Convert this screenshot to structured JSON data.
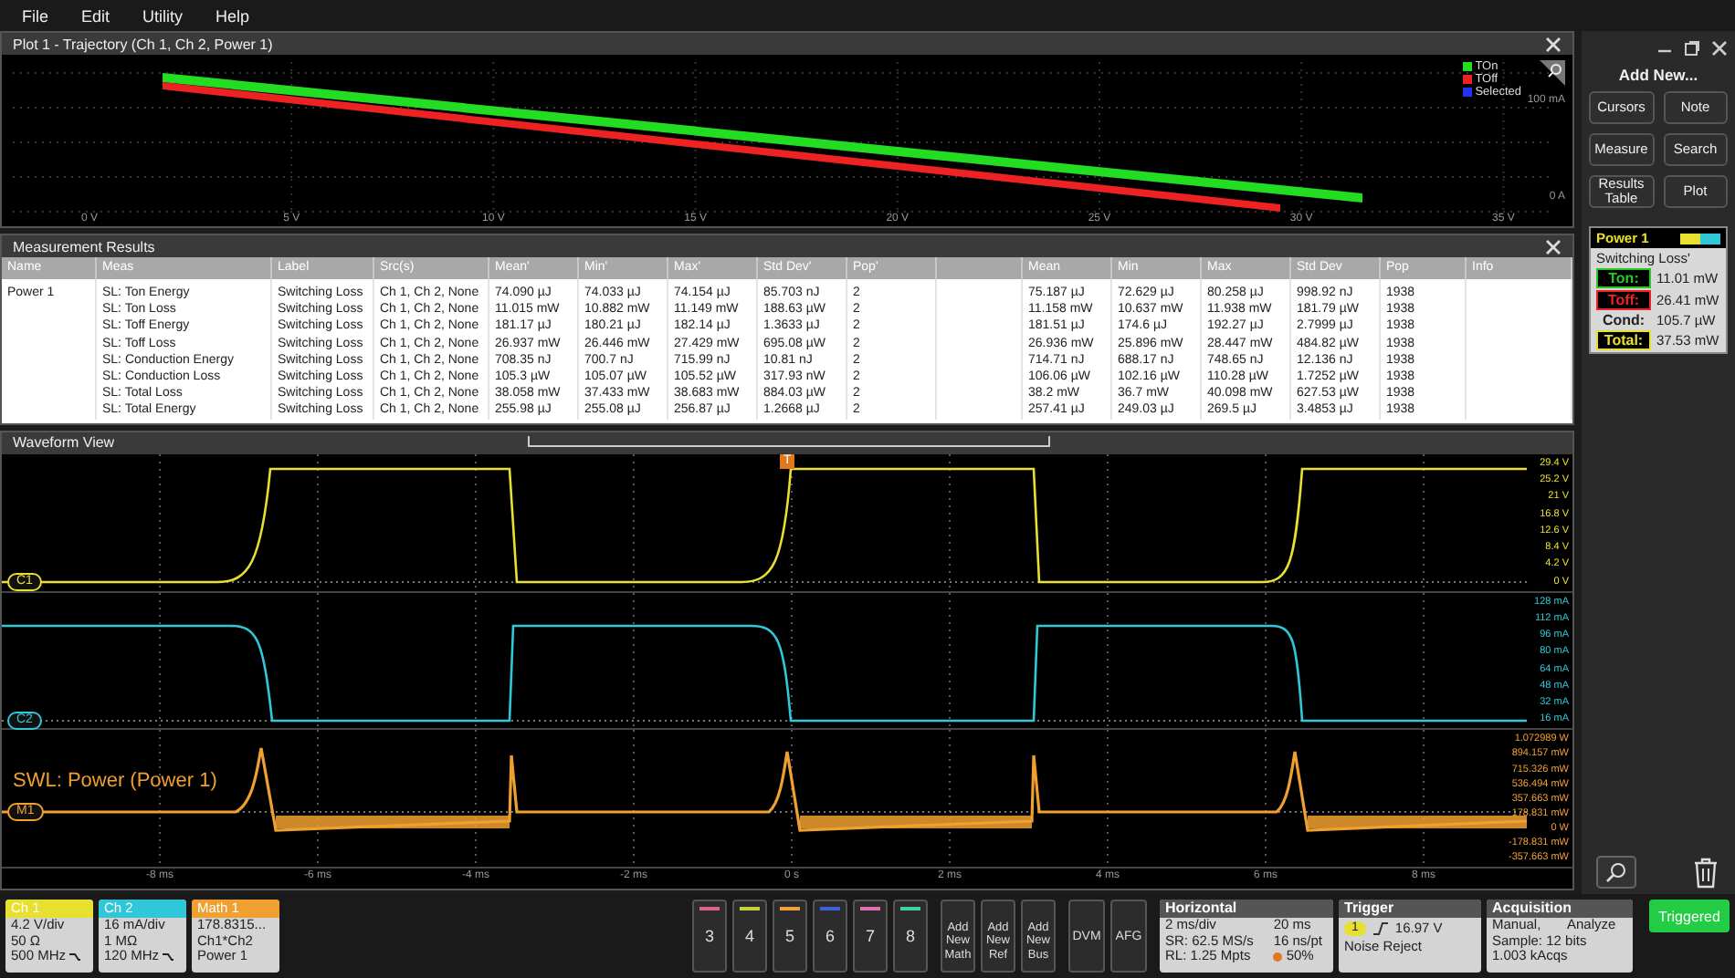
{
  "menu": [
    {
      "label": "File"
    },
    {
      "label": "Edit"
    },
    {
      "label": "Utility"
    },
    {
      "label": "Help"
    }
  ],
  "plot": {
    "title": "Plot 1 - Trajectory (Ch 1, Ch 2, Power 1)",
    "legend": [
      {
        "label": "TOn",
        "color": "#22dd22"
      },
      {
        "label": "TOff",
        "color": "#ee2222"
      },
      {
        "label": "Selected",
        "color": "#2233ee"
      }
    ],
    "x_labels": [
      "0 V",
      "5 V",
      "10 V",
      "15 V",
      "20 V",
      "25 V",
      "30 V",
      "35 V"
    ],
    "y_labels": [
      "100 mA",
      "0 A"
    ]
  },
  "measurement_results": {
    "title": "Measurement Results",
    "columns": [
      "Name",
      "Meas",
      "Label",
      "Src(s)",
      "Mean'",
      "Min'",
      "Max'",
      "Std Dev'",
      "Pop'"
    ],
    "stats_columns": [
      "Mean",
      "Min",
      "Max",
      "Std Dev",
      "Pop",
      "Info"
    ],
    "rows": [
      {
        "cells": [
          "Power 1",
          "SL: Ton Energy",
          "Switching Loss",
          "Ch 1, Ch 2, None",
          "74.090 µJ",
          "74.033 µJ",
          "74.154 µJ",
          "85.703 nJ",
          "2"
        ],
        "stats": [
          "75.187 µJ",
          "72.629 µJ",
          "80.258 µJ",
          "998.92 nJ",
          "1938"
        ]
      },
      {
        "cells": [
          "",
          "SL: Ton Loss",
          "Switching Loss",
          "Ch 1, Ch 2, None",
          "11.015 mW",
          "10.882 mW",
          "11.149 mW",
          "188.63 µW",
          "2"
        ],
        "stats": [
          "11.158 mW",
          "10.637 mW",
          "11.938 mW",
          "181.79 µW",
          "1938"
        ]
      },
      {
        "cells": [
          "",
          "SL: Toff Energy",
          "Switching Loss",
          "Ch 1, Ch 2, None",
          "181.17 µJ",
          "180.21 µJ",
          "182.14 µJ",
          "1.3633 µJ",
          "2"
        ],
        "stats": [
          "181.51 µJ",
          "174.6 µJ",
          "192.27 µJ",
          "2.7999 µJ",
          "1938"
        ]
      },
      {
        "cells": [
          "",
          "SL: Toff Loss",
          "Switching Loss",
          "Ch 1, Ch 2, None",
          "26.937 mW",
          "26.446 mW",
          "27.429 mW",
          "695.08 µW",
          "2"
        ],
        "stats": [
          "26.936 mW",
          "25.896 mW",
          "28.447 mW",
          "484.82 µW",
          "1938"
        ]
      },
      {
        "cells": [
          "",
          "SL: Conduction Energy",
          "Switching Loss",
          "Ch 1, Ch 2, None",
          "708.35 nJ",
          "700.7 nJ",
          "715.99 nJ",
          "10.81 nJ",
          "2"
        ],
        "stats": [
          "714.71 nJ",
          "688.17 nJ",
          "748.65 nJ",
          "12.136 nJ",
          "1938"
        ]
      },
      {
        "cells": [
          "",
          "SL: Conduction Loss",
          "Switching Loss",
          "Ch 1, Ch 2, None",
          "105.3 µW",
          "105.07 µW",
          "105.52 µW",
          "317.93 nW",
          "2"
        ],
        "stats": [
          "106.06 µW",
          "102.16 µW",
          "110.28 µW",
          "1.7252 µW",
          "1938"
        ]
      },
      {
        "cells": [
          "",
          "SL: Total Loss",
          "Switching Loss",
          "Ch 1, Ch 2, None",
          "38.058 mW",
          "37.433 mW",
          "38.683 mW",
          "884.03 µW",
          "2"
        ],
        "stats": [
          "38.2 mW",
          "36.7 mW",
          "40.098 mW",
          "627.53 µW",
          "1938"
        ]
      },
      {
        "cells": [
          "",
          "SL: Total Energy",
          "Switching Loss",
          "Ch 1, Ch 2, None",
          "255.98 µJ",
          "255.08 µJ",
          "256.87 µJ",
          "1.2668 µJ",
          "2"
        ],
        "stats": [
          "257.41 µJ",
          "249.03 µJ",
          "269.5 µJ",
          "3.4853 µJ",
          "1938"
        ]
      }
    ]
  },
  "waveform_view": {
    "title": "Waveform View",
    "trigger_marker": "T",
    "lanes": [
      {
        "kind": "voltage",
        "badge": "C1",
        "color": "#e8e030",
        "scale": [
          "29.4 V",
          "25.2 V",
          "21 V",
          "16.8 V",
          "12.6 V",
          "8.4 V",
          "4.2 V",
          "0 V"
        ]
      },
      {
        "kind": "current",
        "badge": "C2",
        "color": "#30c8d8",
        "scale": [
          "128 mA",
          "112 mA",
          "96 mA",
          "80 mA",
          "64 mA",
          "48 mA",
          "32 mA",
          "16 mA"
        ]
      },
      {
        "kind": "power",
        "badge": "M1",
        "color": "#f0a030",
        "title": "SWL: Power (Power 1)",
        "scale": [
          "1.072989 W",
          "894.157 mW",
          "715.326 mW",
          "536.494 mW",
          "357.663 mW",
          "178.831 mW",
          "0 W",
          "-178.831 mW",
          "-357.663 mW"
        ]
      }
    ],
    "x_labels": [
      "-8 ms",
      "-6 ms",
      "-4 ms",
      "-2 ms",
      "0 s",
      "2 ms",
      "4 ms",
      "6 ms",
      "8 ms"
    ]
  },
  "side_panel": {
    "title": "Add New...",
    "buttons": [
      "Cursors",
      "Note",
      "Measure",
      "Search",
      "Results Table",
      "Plot"
    ],
    "badge": {
      "title": "Power 1",
      "subtitle": "Switching Loss'",
      "rows": [
        {
          "label": "Ton:",
          "value": "11.01 mW",
          "color": "#22cc22"
        },
        {
          "label": "Toff:",
          "value": "26.41 mW",
          "color": "#ee2222"
        },
        {
          "label": "Cond:",
          "value": "105.7 µW"
        },
        {
          "label": "Total:",
          "value": "37.53 mW",
          "color": "#e8e030"
        }
      ]
    }
  },
  "bottom_bar": {
    "channels": [
      {
        "title": "Ch 1",
        "color": "#e8e030",
        "lines": [
          "4.2 V/div",
          "50 Ω",
          "500 MHz"
        ],
        "filter": true
      },
      {
        "title": "Ch 2",
        "color": "#30c8d8",
        "lines": [
          "16 mA/div",
          "1 MΩ",
          "120 MHz"
        ],
        "filter": true
      },
      {
        "title": "Math 1",
        "color": "#f0a030",
        "lines": [
          "178.8315...",
          "Ch1*Ch2",
          "Power 1"
        ],
        "filter": false
      }
    ],
    "slots": [
      {
        "label": "3",
        "color": "#e0608a"
      },
      {
        "label": "4",
        "color": "#c8d040"
      },
      {
        "label": "5",
        "color": "#f0a040"
      },
      {
        "label": "6",
        "color": "#4060e0"
      },
      {
        "label": "7",
        "color": "#e070b0"
      },
      {
        "label": "8",
        "color": "#40d0a0"
      }
    ],
    "add_buttons": [
      "Add New Math",
      "Add New Ref",
      "Add New Bus"
    ],
    "tools": [
      "DVM",
      "AFG"
    ],
    "horizontal": {
      "title": "Horizontal",
      "cells": [
        "2 ms/div",
        "20 ms",
        "SR: 62.5 MS/s",
        "16 ns/pt",
        "RL: 1.25 Mpts",
        "50%"
      ]
    },
    "trigger": {
      "title": "Trigger",
      "source": "1",
      "level": "16.97 V",
      "mode": "Noise Reject"
    },
    "acquisition": {
      "title": "Acquisition",
      "cells": [
        "Manual,",
        "Analyze",
        "Sample: 12 bits",
        "1.003 kAcqs"
      ]
    },
    "status": "Triggered"
  }
}
